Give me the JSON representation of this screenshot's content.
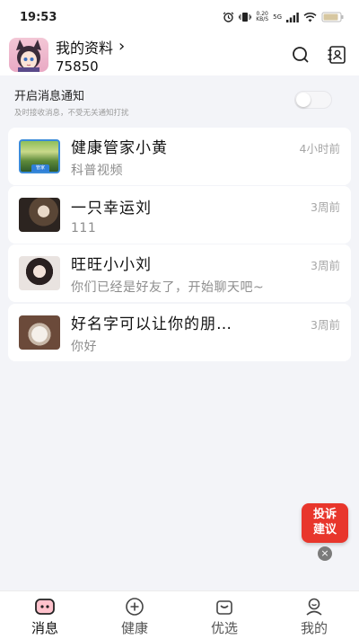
{
  "status_bar": {
    "time": "19:53",
    "net_speed_value": "0.20",
    "net_speed_unit": "KB/S",
    "network": "5G"
  },
  "header": {
    "title": "我的资料",
    "title_chevron": "›",
    "user_id": "75850",
    "search_icon": "search-icon",
    "contacts_icon": "contacts-icon"
  },
  "notification": {
    "title": "开启消息通知",
    "subtitle": "及时接收消息，不受无关通知打扰",
    "enabled": false
  },
  "conversations": [
    {
      "name": "健康管家小黄",
      "message": "科普视频",
      "time": "4小时前",
      "badge": "管家"
    },
    {
      "name": "一只幸运刘",
      "message": "111",
      "time": "3周前"
    },
    {
      "name": "旺旺小小刘",
      "message": "你们已经是好友了，开始聊天吧~",
      "time": "3周前"
    },
    {
      "name": "好名字可以让你的朋…",
      "message": "你好",
      "time": "3周前"
    }
  ],
  "feedback": {
    "line1": "投诉",
    "line2": "建议",
    "close": "×"
  },
  "tabs": [
    {
      "label": "消息",
      "icon": "message-icon",
      "active": true
    },
    {
      "label": "健康",
      "icon": "plus-circle-icon",
      "active": false
    },
    {
      "label": "优选",
      "icon": "shopping-bag-icon",
      "active": false
    },
    {
      "label": "我的",
      "icon": "profile-icon",
      "active": false
    }
  ],
  "colors": {
    "accent_red": "#e8362c",
    "background": "#f3f4f8",
    "card": "#ffffff",
    "muted_text": "#8d8d8d"
  }
}
